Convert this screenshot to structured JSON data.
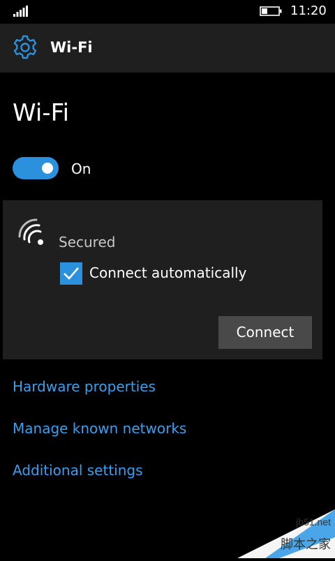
{
  "status_bar": {
    "time": "11:20"
  },
  "header": {
    "title": "Wi-Fi",
    "icon": "gear-icon"
  },
  "page": {
    "title": "Wi-Fi"
  },
  "wifi_toggle": {
    "state": "On",
    "on": true,
    "color": "#2b91dd"
  },
  "network": {
    "security": "Secured",
    "auto_connect_label": "Connect automatically",
    "auto_connect_checked": true,
    "connect_label": "Connect"
  },
  "links": {
    "hardware_properties": "Hardware properties",
    "manage_known_networks": "Manage known networks",
    "additional_settings": "Additional settings"
  },
  "watermark": {
    "site": "jb51.net",
    "brand": "脚本之家"
  }
}
